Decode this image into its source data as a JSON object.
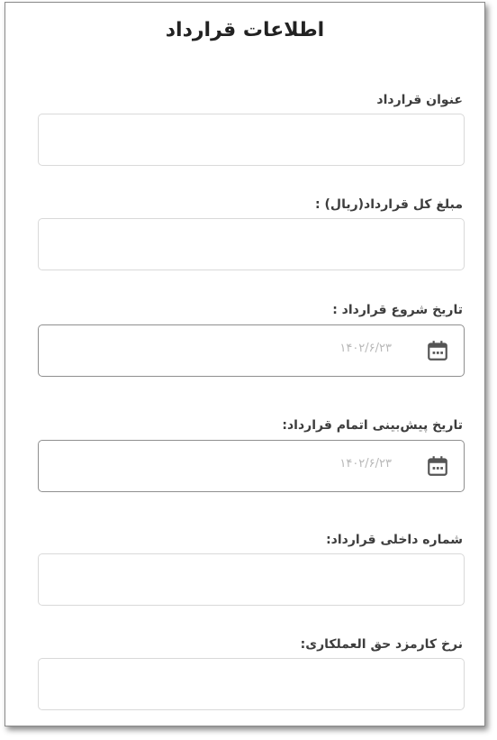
{
  "form": {
    "title": "اطلاعات قرارداد",
    "fields": [
      {
        "label": "عنوان قرارداد",
        "value": "",
        "placeholder": ""
      },
      {
        "label": "مبلغ کل قرارداد(ریال) :",
        "value": "",
        "placeholder": ""
      },
      {
        "label": "تاریخ شروع قرارداد :",
        "date_text": "۱۴۰۲/۶/۲۳",
        "icon": "calendar-icon"
      },
      {
        "label": "تاریخ پیش‌بینی اتمام قرارداد:",
        "date_text": "۱۴۰۲/۶/۲۳",
        "icon": "calendar-icon"
      },
      {
        "label": "شماره داخلی قرارداد:",
        "value": "",
        "placeholder": ""
      },
      {
        "label": "نرخ کارمزد حق العملکاری:",
        "value": "",
        "placeholder": ""
      }
    ]
  },
  "colors": {
    "input_border": "#d9d9d9",
    "date_border": "#8f8f8f",
    "placeholder_text": "#b8b8b8",
    "icon": "#555555"
  }
}
